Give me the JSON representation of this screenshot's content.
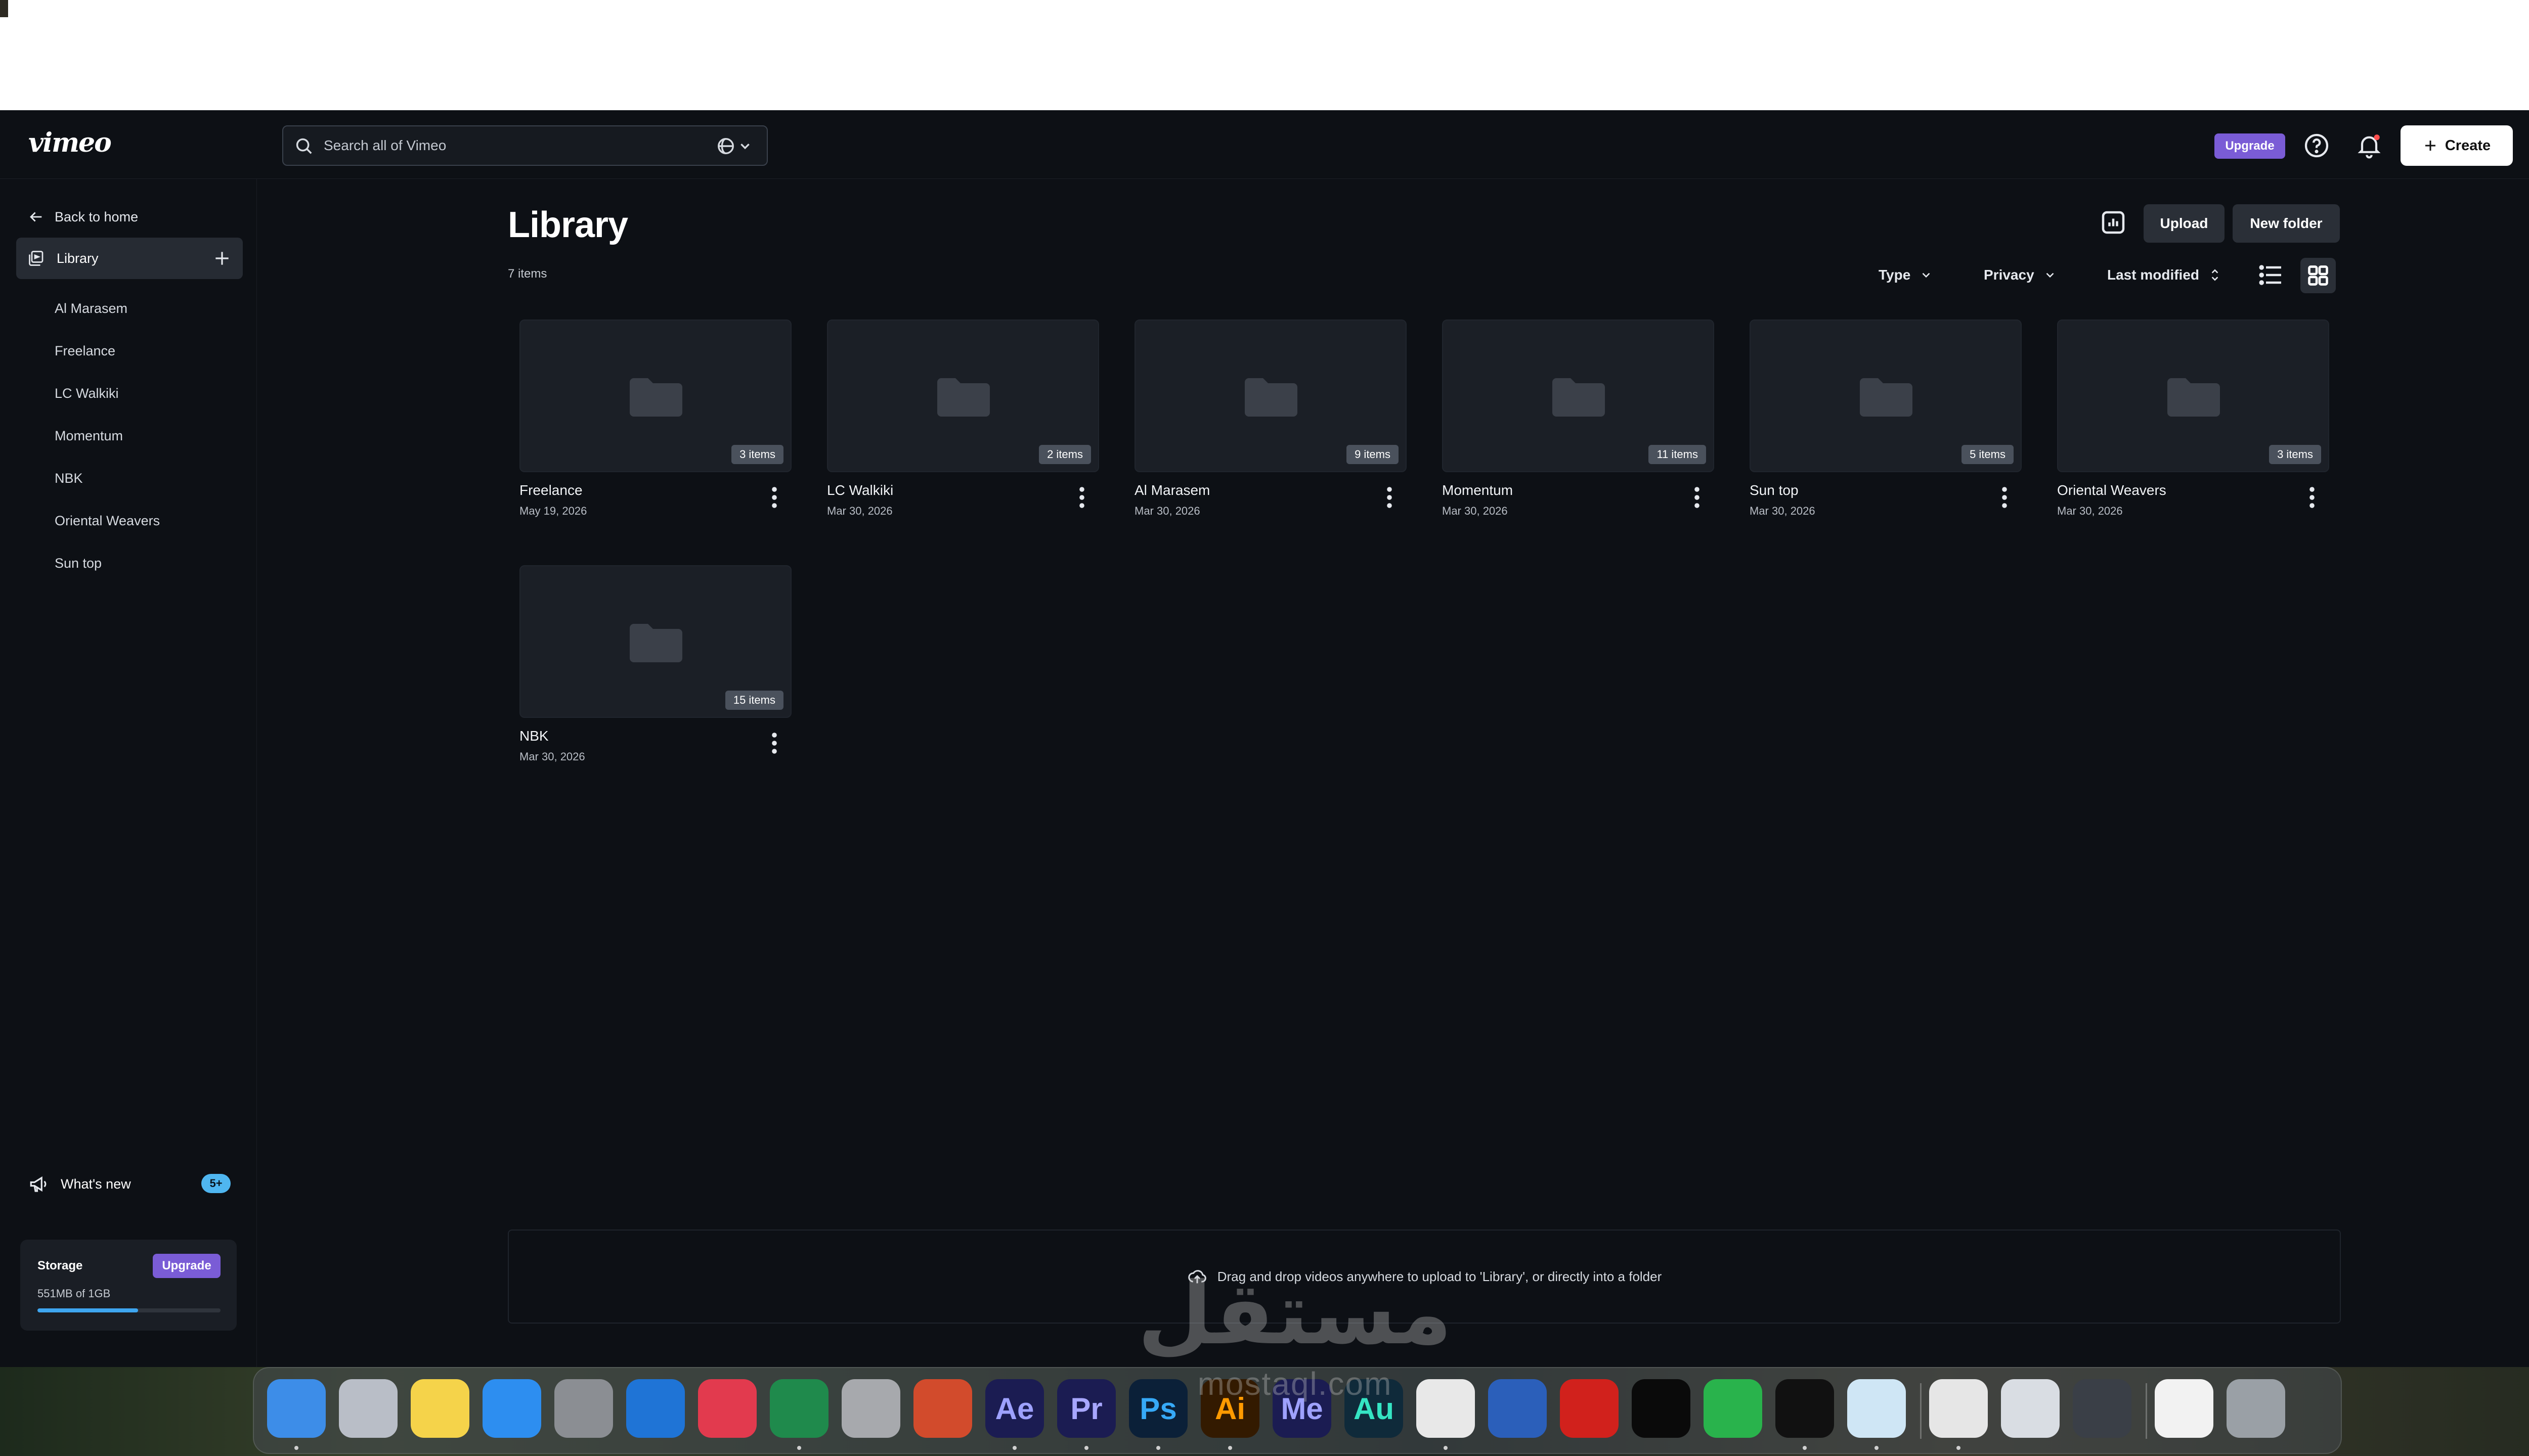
{
  "header": {
    "logo": "vimeo",
    "search_placeholder": "Search all of Vimeo",
    "upgrade_label": "Upgrade",
    "create_label": "Create"
  },
  "sidebar": {
    "back_label": "Back to home",
    "library_label": "Library",
    "folders": [
      "Al Marasem",
      "Freelance",
      "LC Walkiki",
      "Momentum",
      "NBK",
      "Oriental Weavers",
      "Sun top"
    ],
    "whats_new_label": "What's new",
    "whats_new_badge": "5+",
    "storage": {
      "title": "Storage",
      "upgrade_label": "Upgrade",
      "used_text": "551MB of 1GB",
      "used_fraction": 0.551
    }
  },
  "main": {
    "title": "Library",
    "count": "7 items",
    "upload_label": "Upload",
    "new_folder_label": "New folder",
    "filters": {
      "type": "Type",
      "privacy": "Privacy",
      "sort": "Last modified"
    },
    "cards": [
      {
        "name": "Freelance",
        "date": "May 19, 2026",
        "items": "3 items"
      },
      {
        "name": "LC Walkiki",
        "date": "Mar 30, 2026",
        "items": "2 items"
      },
      {
        "name": "Al Marasem",
        "date": "Mar 30, 2026",
        "items": "9 items"
      },
      {
        "name": "Momentum",
        "date": "Mar 30, 2026",
        "items": "11 items"
      },
      {
        "name": "Sun top",
        "date": "Mar 30, 2026",
        "items": "5 items"
      },
      {
        "name": "Oriental Weavers",
        "date": "Mar 30, 2026",
        "items": "3 items"
      },
      {
        "name": "NBK",
        "date": "Mar 30, 2026",
        "items": "15 items"
      }
    ],
    "dropzone_text": "Drag and drop videos anywhere to upload to 'Library', or directly into a folder"
  },
  "dock": {
    "apps": [
      {
        "name": "finder-icon",
        "glyph": "",
        "bg": "#3d8de8"
      },
      {
        "name": "launchpad-icon",
        "glyph": "",
        "bg": "#b9bec7"
      },
      {
        "name": "notes-icon",
        "glyph": "",
        "bg": "#f5d34a"
      },
      {
        "name": "safari-icon",
        "glyph": "",
        "bg": "#2d8ef0"
      },
      {
        "name": "system-settings-icon",
        "glyph": "",
        "bg": "#8b8e93"
      },
      {
        "name": "outlook-icon",
        "glyph": "",
        "bg": "#1f74d6"
      },
      {
        "name": "creative-cloud-icon",
        "glyph": "",
        "bg": "#e23a4e"
      },
      {
        "name": "excel-icon",
        "glyph": "",
        "bg": "#1f8a4c"
      },
      {
        "name": "font-book-icon",
        "glyph": "",
        "bg": "#a7a9ad"
      },
      {
        "name": "powerpoint-icon",
        "glyph": "",
        "bg": "#d24b2c"
      },
      {
        "name": "after-effects-icon",
        "glyph": "Ae",
        "bg": "#1b1c52",
        "fg": "#9ea1ff"
      },
      {
        "name": "premiere-icon",
        "glyph": "Pr",
        "bg": "#1b1c52",
        "fg": "#a8a7ff"
      },
      {
        "name": "photoshop-icon",
        "glyph": "Ps",
        "bg": "#0b2038",
        "fg": "#36a9f7"
      },
      {
        "name": "illustrator-icon",
        "glyph": "Ai",
        "bg": "#331a00",
        "fg": "#ff9a00"
      },
      {
        "name": "media-encoder-icon",
        "glyph": "Me",
        "bg": "#1b1c52",
        "fg": "#9ea1ff"
      },
      {
        "name": "audition-icon",
        "glyph": "Au",
        "bg": "#0f2a3a",
        "fg": "#35e4c3"
      },
      {
        "name": "chrome-icon",
        "glyph": "",
        "bg": "#e8e8e8"
      },
      {
        "name": "word-icon",
        "glyph": "",
        "bg": "#2b5fba"
      },
      {
        "name": "acrobat-icon",
        "glyph": "",
        "bg": "#d1211c"
      },
      {
        "name": "tiktok-icon",
        "glyph": "",
        "bg": "#0a0a0a"
      },
      {
        "name": "whatsapp-icon",
        "glyph": "",
        "bg": "#29b34c"
      },
      {
        "name": "spotify-icon",
        "glyph": "",
        "bg": "#111111"
      },
      {
        "name": "pineapple-app-icon",
        "glyph": "",
        "bg": "#cfe6f5"
      },
      {
        "name": "preview-icon",
        "glyph": "",
        "bg": "#e6e6e6"
      },
      {
        "name": "image-capture-icon",
        "glyph": "",
        "bg": "#d9dde3"
      },
      {
        "name": "quicktime-icon",
        "glyph": "",
        "bg": "#3a3f47"
      },
      {
        "name": "zip-file-icon",
        "glyph": "",
        "bg": "#f2f2f2"
      },
      {
        "name": "trash-icon",
        "glyph": "",
        "bg": "#9aa0a6"
      }
    ]
  },
  "watermark": {
    "arabic": "مستقل",
    "latin": "mostaql.com"
  }
}
